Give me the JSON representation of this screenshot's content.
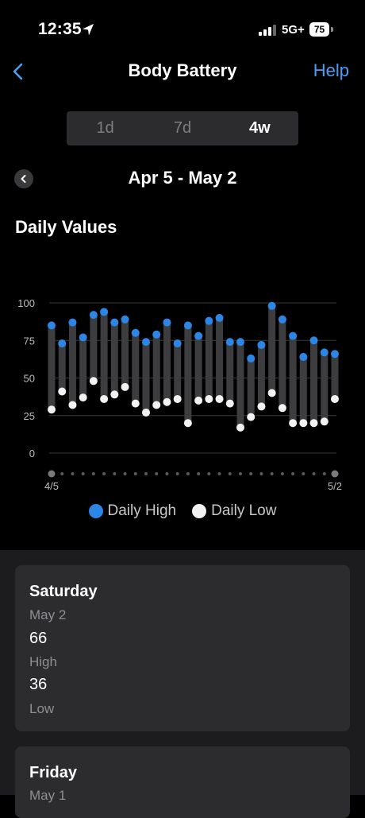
{
  "status_bar": {
    "time": "12:35",
    "network": "5G+",
    "battery": "75"
  },
  "nav": {
    "title": "Body Battery",
    "help_label": "Help"
  },
  "range_tabs": [
    {
      "label": "1d",
      "active": false
    },
    {
      "label": "7d",
      "active": false
    },
    {
      "label": "4w",
      "active": true
    }
  ],
  "date_range": "Apr 5 - May 2",
  "section_title": "Daily Values",
  "colors": {
    "accent": "#4a9ff5",
    "high_dot": "#2b86e5",
    "low_dot": "#f2f2f2",
    "bar": "#3d3d3f"
  },
  "chart_data": {
    "type": "range-bar",
    "y_ticks": [
      "100",
      "75",
      "50",
      "25",
      "0"
    ],
    "ylim": [
      0,
      100
    ],
    "x_start_label": "4/5",
    "x_end_label": "5/2",
    "series": [
      {
        "name": "Daily High",
        "values": [
          85,
          73,
          87,
          77,
          92,
          94,
          87,
          89,
          80,
          74,
          79,
          87,
          73,
          85,
          78,
          88,
          90,
          74,
          74,
          63,
          72,
          98,
          89,
          78,
          64,
          75,
          67,
          66
        ]
      },
      {
        "name": "Daily Low",
        "values": [
          29,
          41,
          32,
          37,
          48,
          36,
          39,
          44,
          33,
          27,
          32,
          34,
          36,
          20,
          35,
          36,
          36,
          33,
          17,
          24,
          31,
          40,
          30,
          20,
          20,
          20,
          21,
          36
        ]
      }
    ]
  },
  "cards": [
    {
      "day": "Saturday",
      "date": "May 2",
      "high": "66",
      "high_label": "High",
      "low": "36",
      "low_label": "Low"
    },
    {
      "day": "Friday",
      "date": "May 1"
    }
  ]
}
